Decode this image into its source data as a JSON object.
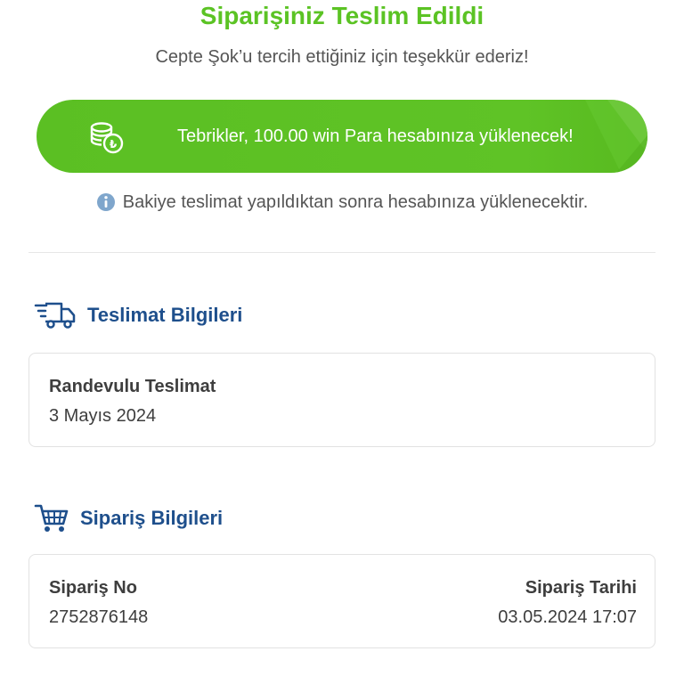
{
  "header": {
    "title": "Siparişiniz Teslim Edildi",
    "subtitle": "Cepte Şok’u tercih ettiğiniz için teşekkür ederiz!"
  },
  "banner": {
    "text": "Tebrikler, 100.00 win Para hesabınıza yüklenecek!",
    "icon": "coins-icon",
    "color": "#5bc324"
  },
  "info": {
    "icon": "info-icon",
    "text": "Bakiye teslimat yapıldıktan sonra hesabınıza yüklenecektir."
  },
  "delivery_section": {
    "title": "Teslimat Bilgileri",
    "icon": "delivery-truck-icon",
    "type_label": "Randevulu Teslimat",
    "date": "3 Mayıs 2024"
  },
  "order_section": {
    "title": "Sipariş Bilgileri",
    "icon": "shopping-cart-icon",
    "order_no_label": "Sipariş No",
    "order_no": "2752876148",
    "order_date_label": "Sipariş Tarihi",
    "order_date": "03.05.2024 17:07"
  },
  "colors": {
    "accent_green": "#5bc324",
    "section_blue": "#1e4f8c",
    "info_blue": "#7fa6cc"
  }
}
